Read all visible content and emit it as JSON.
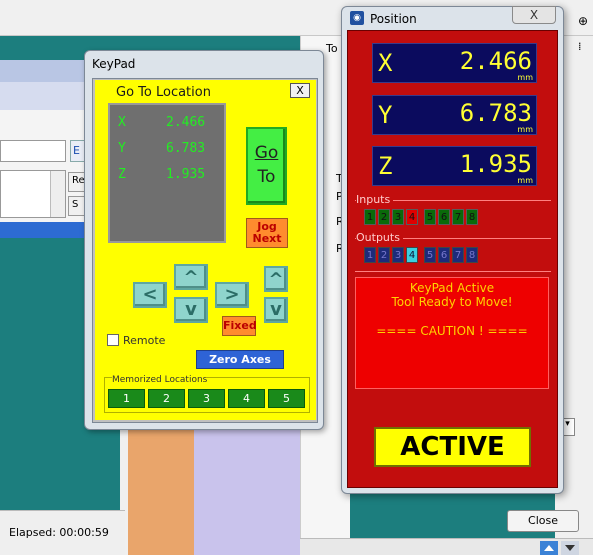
{
  "background": {
    "elapsed": "Elapsed: 00:00:59",
    "close_button": "Close",
    "e_button": "E",
    "re_button": "Re",
    "s_button": "S",
    "to_label": "To",
    "t_label": "T",
    "p1": "P",
    "p2": "P",
    "r1": "R",
    "r2": "R",
    "pin_glyph": "⊕",
    "dots_glyph": "⁞",
    "down_glyph": "▾"
  },
  "keypad": {
    "title": "KeyPad",
    "close": "X",
    "heading": "Go To Location",
    "readout": [
      {
        "axis": "X",
        "value": "2.466"
      },
      {
        "axis": "Y",
        "value": "6.783"
      },
      {
        "axis": "Z",
        "value": "1.935"
      }
    ],
    "goto_line1": "Go",
    "goto_line2": "To",
    "jog_line1": "Jog",
    "jog_line2": "Next",
    "arrows": {
      "up": "^",
      "down": "v",
      "left": "<",
      "right": ">",
      "z_up": "^",
      "z_down": "v"
    },
    "fixed": "Fixed",
    "remote": "Remote",
    "zero_axes": "Zero Axes",
    "memorized_title": "Memorized Locations",
    "memorized": [
      "1",
      "2",
      "3",
      "4",
      "5"
    ]
  },
  "position": {
    "title": "Position",
    "close": "X",
    "axes": [
      {
        "axis": "X",
        "value": "2.466",
        "unit": "mm"
      },
      {
        "axis": "Y",
        "value": "6.783",
        "unit": "mm"
      },
      {
        "axis": "Z",
        "value": "1.935",
        "unit": "mm"
      }
    ],
    "inputs_label": "Inputs",
    "inputs": [
      "1",
      "2",
      "3",
      "4",
      "5",
      "6",
      "7",
      "8"
    ],
    "outputs_label": "Outputs",
    "outputs": [
      "1",
      "2",
      "3",
      "4",
      "5",
      "6",
      "7",
      "8"
    ],
    "message_line1": "KeyPad Active",
    "message_line2": "Tool Ready to Move!",
    "message_line3": "==== CAUTION ! ====",
    "active_button": "ACTIVE",
    "colors": {
      "panel": "#c20d0d",
      "readout_bg": "#0b0b5e",
      "readout_text": "#ffff33",
      "input_active": "#e00000",
      "output_active": "#3ad0e0"
    }
  }
}
